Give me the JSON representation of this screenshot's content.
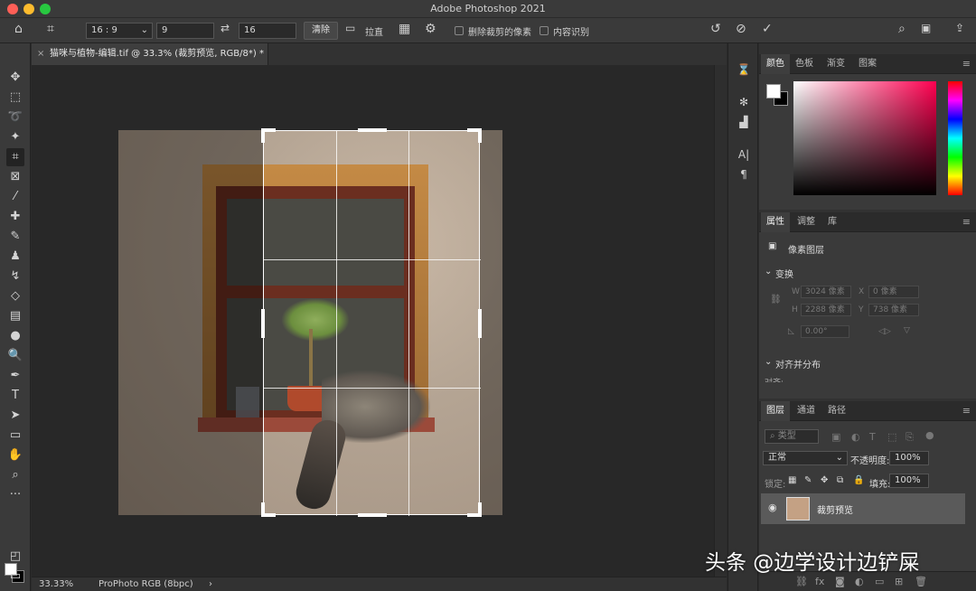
{
  "app": {
    "title": "Adobe Photoshop 2021"
  },
  "options": {
    "ratio": "16 : 9",
    "width_value": "9",
    "height_value": "16",
    "clear_label": "清除",
    "straighten_label": "拉直",
    "delete_cropped_label": "删除裁剪的像素",
    "content_aware_label": "内容识别"
  },
  "document": {
    "tab_label": "猫咪与植物-编辑.tif @ 33.3% (裁剪预览, RGB/8*) *",
    "zoom": "33.33%",
    "profile": "ProPhoto RGB (8bpc)"
  },
  "color_panel": {
    "tabs": [
      "颜色",
      "色板",
      "渐变",
      "图案"
    ],
    "fg_color": "#ffffff",
    "bg_color": "#000000"
  },
  "properties_panel": {
    "tabs": [
      "属性",
      "调整",
      "库"
    ],
    "layer_type": "像素图层",
    "transform_title": "变换",
    "w_label": "W",
    "w_value": "3024 像素",
    "x_label": "X",
    "x_value": "0 像素",
    "h_label": "H",
    "h_value": "2288 像素",
    "y_label": "Y",
    "y_value": "738 像素",
    "angle_value": "0.00°",
    "align_title": "对齐并分布",
    "align_sub": "对齐:"
  },
  "layers_panel": {
    "tabs": [
      "图层",
      "通道",
      "路径"
    ],
    "filter_placeholder": "类型",
    "blend_mode": "正常",
    "opacity_label": "不透明度:",
    "opacity_value": "100%",
    "lock_label": "锁定:",
    "fill_label": "填充:",
    "fill_value": "100%",
    "layer_name": "裁剪预览"
  },
  "watermark": "头条 @边学设计边铲屎",
  "icons": {
    "home": "home-icon",
    "crop": "crop-icon",
    "swap": "swap-icon",
    "grid": "grid-icon",
    "gear": "gear-icon",
    "undo": "undo-icon",
    "cancel": "cancel-icon",
    "commit": "check-icon",
    "search": "search-icon",
    "workspace": "workspace-icon",
    "share": "share-icon"
  }
}
